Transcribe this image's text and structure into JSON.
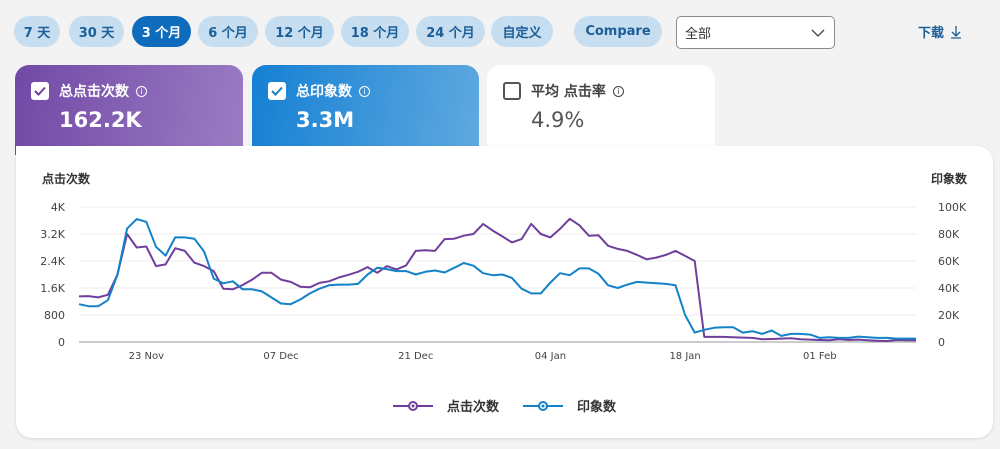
{
  "filters": {
    "ranges": [
      "7 天",
      "30 天",
      "3 个月",
      "6 个月",
      "12 个月",
      "18 个月",
      "24 个月",
      "自定义"
    ],
    "active_index": 2,
    "compare_label": "Compare",
    "select_value": "全部",
    "download_label": "下载"
  },
  "cards": [
    {
      "label": "总点击次数",
      "value": "162.2K",
      "checked": true
    },
    {
      "label": "总印象数",
      "value": "3.3M",
      "checked": true
    },
    {
      "label": "平均 点击率",
      "value": "4.9%",
      "checked": false
    }
  ],
  "colors": {
    "clicks": "#6f3f9b",
    "impressions": "#1382c8",
    "accent": "#0f6cbd"
  },
  "chart_data": {
    "type": "line",
    "xlabel": "",
    "left_axis_title": "点击次数",
    "right_axis_title": "印象数",
    "x_tick_labels": [
      "23 Nov",
      "07 Dec",
      "21 Dec",
      "04 Jan",
      "18 Jan",
      "01 Feb"
    ],
    "x_tick_index": [
      7,
      21,
      35,
      49,
      63,
      77
    ],
    "left_ticks": [
      "0",
      "800",
      "1.6K",
      "2.4K",
      "3.2K",
      "4K"
    ],
    "right_ticks": [
      "0",
      "20K",
      "40K",
      "60K",
      "80K",
      "100K"
    ],
    "ylim_left": [
      0,
      4000
    ],
    "ylim_right": [
      0,
      100000
    ],
    "grid": true,
    "legend_position": "bottom",
    "series": [
      {
        "name": "点击次数",
        "axis": "left",
        "values": [
          1350,
          1360,
          1320,
          1400,
          2000,
          3200,
          2800,
          2830,
          2250,
          2300,
          2780,
          2700,
          2350,
          2250,
          2100,
          1580,
          1560,
          1690,
          1850,
          2050,
          2050,
          1850,
          1780,
          1640,
          1620,
          1750,
          1800,
          1910,
          1990,
          2080,
          2220,
          2050,
          2250,
          2150,
          2270,
          2700,
          2720,
          2700,
          3050,
          3060,
          3150,
          3200,
          3500,
          3300,
          3130,
          2950,
          3050,
          3500,
          3200,
          3100,
          3350,
          3650,
          3460,
          3150,
          3160,
          2850,
          2760,
          2700,
          2580,
          2450,
          2500,
          2580,
          2700,
          2550,
          2400,
          150,
          150,
          150,
          140,
          130,
          120,
          80,
          90,
          100,
          110,
          80,
          70,
          60,
          50,
          80,
          60,
          70,
          50,
          40,
          30,
          60,
          50,
          50
        ]
      },
      {
        "name": "印象数",
        "axis": "right",
        "values": [
          28000,
          26500,
          26500,
          31000,
          50000,
          84000,
          91000,
          89000,
          70500,
          64000,
          77500,
          77500,
          76500,
          67000,
          47000,
          43500,
          45000,
          39000,
          39000,
          37500,
          33000,
          28500,
          28000,
          31500,
          36000,
          39500,
          42000,
          42500,
          42500,
          43000,
          50000,
          55000,
          54000,
          52500,
          52500,
          50000,
          52000,
          53000,
          51500,
          55000,
          58500,
          56500,
          51000,
          49500,
          50000,
          47500,
          39500,
          36000,
          36000,
          44000,
          51000,
          49500,
          54500,
          54500,
          50500,
          42000,
          40000,
          42500,
          44500,
          44000,
          43500,
          43000,
          42000,
          20000,
          7000,
          9000,
          10500,
          11000,
          11000,
          7000,
          8000,
          6000,
          8500,
          4500,
          6000,
          6000,
          5500,
          3000,
          3500,
          3000,
          3000,
          4000,
          3500,
          3000,
          3000,
          2500,
          2500,
          2500
        ]
      }
    ]
  }
}
